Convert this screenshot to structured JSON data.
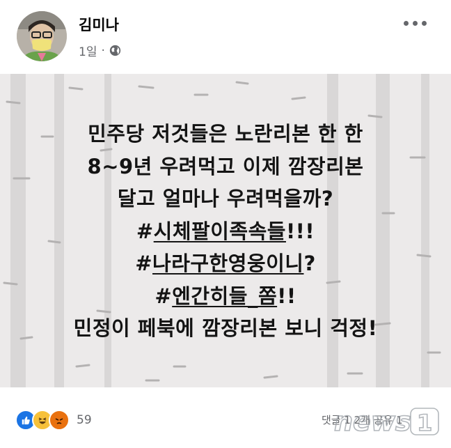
{
  "post": {
    "author": "김미나",
    "time": "1일",
    "separator": "·",
    "privacy_icon": "globe-icon",
    "more_icon": "more-horizontal-icon",
    "text_lines": [
      {
        "plain": "민주당 저것들은 노란리본 한 한"
      },
      {
        "plain": "8~9년 우려먹고 이제 깜장리본"
      },
      {
        "plain": "달고 얼마나 우려먹을까?"
      },
      {
        "prefix": "#",
        "tag": "시체팔이족속들",
        "suffix": "!!!"
      },
      {
        "prefix": "#",
        "tag": "나라구한영웅이니",
        "suffix": "?"
      },
      {
        "prefix": "#",
        "tag": "엔간히들_쫌",
        "suffix": "!!"
      },
      {
        "plain": "민정이 페북에 깜장리본 보니 걱정!"
      }
    ],
    "background_color": "#eceaea"
  },
  "footer": {
    "reaction_icons": [
      "like-icon",
      "haha-icon",
      "angry-icon"
    ],
    "reaction_count": "59",
    "comments_label": "댓글 1 2개 공유 1"
  },
  "watermark": {
    "label": "news1"
  }
}
